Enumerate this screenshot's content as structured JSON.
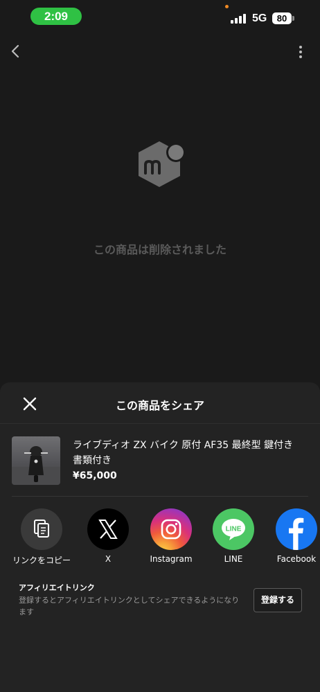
{
  "status_bar": {
    "time": "2:09",
    "network": "5G",
    "battery": "80",
    "colors": {
      "time_pill": "#2fc144"
    }
  },
  "nav": {
    "back_icon": "chevron-left-icon",
    "more_icon": "more-vertical-icon"
  },
  "deleted": {
    "logo_icon": "mercari-logo-icon",
    "message": "この商品は削除されました"
  },
  "share_sheet": {
    "title": "この商品をシェア",
    "close_icon": "close-icon",
    "product": {
      "title": "ライブディオ ZX バイク 原付 AF35 最終型 鍵付き　書類付き",
      "price": "¥65,000"
    },
    "options": [
      {
        "label": "リンクをコピー",
        "icon": "copy-icon",
        "color": "#3a3a3a"
      },
      {
        "label": "X",
        "icon": "x-logo-icon",
        "color": "#000000"
      },
      {
        "label": "Instagram",
        "icon": "instagram-icon",
        "color": "#e1306c"
      },
      {
        "label": "LINE",
        "icon": "line-icon",
        "color": "#4cc764"
      },
      {
        "label": "Facebook",
        "icon": "facebook-icon",
        "color": "#1877f2"
      }
    ],
    "affiliate": {
      "title": "アフィリエイトリンク",
      "description": "登録するとアフィリエイトリンクとしてシェアできるようになります",
      "button": "登録する"
    }
  }
}
